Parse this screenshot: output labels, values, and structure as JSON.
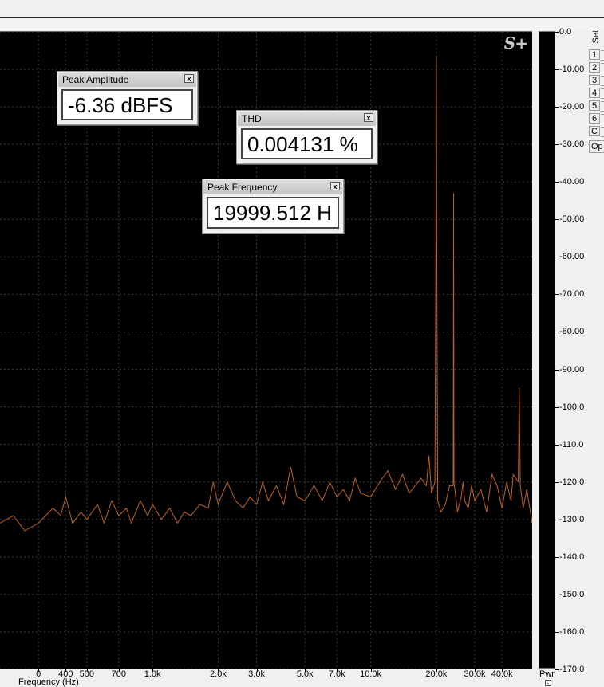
{
  "logo_text": "S+",
  "windows": {
    "peak_amplitude": {
      "title": "Peak Amplitude",
      "value": "-6.36 dBFS",
      "close": "x"
    },
    "thd": {
      "title": "THD",
      "value": "0.004131 %",
      "close": "x"
    },
    "peak_frequency": {
      "title": "Peak Frequency",
      "value": "19999.512 H",
      "close": "x"
    }
  },
  "right_panel": {
    "set_label": "Set",
    "buttons": [
      "1",
      "2",
      "3",
      "4",
      "5",
      "6",
      "C"
    ],
    "options_label": "Op"
  },
  "footer": {
    "xlabel": "Frequency (Hz)",
    "pwr_label": "Pwr",
    "pwr_toggle": "-"
  },
  "colors": {
    "trace": "#c0621a",
    "background": "#000000",
    "grid": "#3c3c3c"
  },
  "chart_data": {
    "type": "line",
    "title": "",
    "xlabel": "Frequency (Hz)",
    "ylabel": "",
    "xscale": "log",
    "xlim": [
      200,
      55000
    ],
    "ylim": [
      -170,
      0
    ],
    "grid": true,
    "x_ticks": [
      {
        "v": 300,
        "label": "0"
      },
      {
        "v": 400,
        "label": "400"
      },
      {
        "v": 500,
        "label": "500"
      },
      {
        "v": 700,
        "label": "700"
      },
      {
        "v": 1000,
        "label": "1.0k"
      },
      {
        "v": 2000,
        "label": "2.0k"
      },
      {
        "v": 3000,
        "label": "3.0k"
      },
      {
        "v": 5000,
        "label": "5.0k"
      },
      {
        "v": 7000,
        "label": "7.0k"
      },
      {
        "v": 10000,
        "label": "10.0k"
      },
      {
        "v": 20000,
        "label": "20.0k"
      },
      {
        "v": 30000,
        "label": "30.0k"
      },
      {
        "v": 40000,
        "label": "40.0k"
      }
    ],
    "y_ticks": [
      {
        "v": 0,
        "label": "0.0"
      },
      {
        "v": -10,
        "label": "-10.00"
      },
      {
        "v": -20,
        "label": "-20.00"
      },
      {
        "v": -30,
        "label": "-30.00"
      },
      {
        "v": -40,
        "label": "-40.00"
      },
      {
        "v": -50,
        "label": "-50.00"
      },
      {
        "v": -60,
        "label": "-60.00"
      },
      {
        "v": -70,
        "label": "-70.00"
      },
      {
        "v": -80,
        "label": "-80.00"
      },
      {
        "v": -90,
        "label": "-90.00"
      },
      {
        "v": -100,
        "label": "-100.0"
      },
      {
        "v": -110,
        "label": "-110.0"
      },
      {
        "v": -120,
        "label": "-120.0"
      },
      {
        "v": -130,
        "label": "-130.0"
      },
      {
        "v": -140,
        "label": "-140.0"
      },
      {
        "v": -150,
        "label": "-150.0"
      },
      {
        "v": -160,
        "label": "-160.0"
      },
      {
        "v": -170,
        "label": "-170.0"
      }
    ],
    "series": [
      {
        "points": [
          [
            200,
            -131
          ],
          [
            230,
            -129
          ],
          [
            260,
            -133
          ],
          [
            300,
            -131
          ],
          [
            350,
            -127
          ],
          [
            380,
            -129
          ],
          [
            400,
            -124
          ],
          [
            430,
            -131
          ],
          [
            470,
            -128
          ],
          [
            500,
            -130
          ],
          [
            560,
            -126
          ],
          [
            600,
            -131
          ],
          [
            650,
            -125
          ],
          [
            700,
            -129
          ],
          [
            760,
            -127
          ],
          [
            800,
            -131
          ],
          [
            880,
            -125
          ],
          [
            950,
            -129
          ],
          [
            1000,
            -126
          ],
          [
            1100,
            -130
          ],
          [
            1200,
            -127
          ],
          [
            1300,
            -131
          ],
          [
            1400,
            -128
          ],
          [
            1500,
            -129
          ],
          [
            1650,
            -126
          ],
          [
            1800,
            -127
          ],
          [
            1900,
            -120
          ],
          [
            2000,
            -126
          ],
          [
            2200,
            -120
          ],
          [
            2400,
            -125
          ],
          [
            2600,
            -127
          ],
          [
            2800,
            -124
          ],
          [
            3000,
            -126
          ],
          [
            3200,
            -120
          ],
          [
            3400,
            -125
          ],
          [
            3700,
            -121
          ],
          [
            4000,
            -126
          ],
          [
            4300,
            -116
          ],
          [
            4600,
            -124
          ],
          [
            5000,
            -125
          ],
          [
            5500,
            -121
          ],
          [
            6000,
            -125
          ],
          [
            6500,
            -120
          ],
          [
            7000,
            -124
          ],
          [
            7500,
            -122
          ],
          [
            8000,
            -125
          ],
          [
            8500,
            -119
          ],
          [
            9000,
            -123
          ],
          [
            10000,
            -124
          ],
          [
            11000,
            -120
          ],
          [
            12000,
            -117
          ],
          [
            13000,
            -122
          ],
          [
            14000,
            -118
          ],
          [
            15000,
            -123
          ],
          [
            16000,
            -121
          ],
          [
            17000,
            -119
          ],
          [
            18000,
            -121
          ],
          [
            18500,
            -113
          ],
          [
            19000,
            -123
          ],
          [
            19700,
            -120
          ],
          [
            19900,
            -60
          ],
          [
            20000,
            -6.36
          ],
          [
            20100,
            -60
          ],
          [
            20300,
            -125
          ],
          [
            21000,
            -128
          ],
          [
            22000,
            -126
          ],
          [
            23000,
            -121
          ],
          [
            23900,
            -121
          ],
          [
            24000,
            -43
          ],
          [
            24100,
            -120
          ],
          [
            25000,
            -128
          ],
          [
            26000,
            -124
          ],
          [
            26500,
            -120
          ],
          [
            27000,
            -125
          ],
          [
            28000,
            -127
          ],
          [
            29000,
            -121
          ],
          [
            30000,
            -125
          ],
          [
            32000,
            -122
          ],
          [
            34000,
            -128
          ],
          [
            36000,
            -118
          ],
          [
            38000,
            -121
          ],
          [
            40000,
            -127
          ],
          [
            42000,
            -120
          ],
          [
            44000,
            -125
          ],
          [
            45000,
            -118
          ],
          [
            47500,
            -120
          ],
          [
            48000,
            -95
          ],
          [
            48500,
            -121
          ],
          [
            50000,
            -127
          ],
          [
            52000,
            -122
          ],
          [
            55000,
            -131
          ]
        ]
      }
    ]
  }
}
